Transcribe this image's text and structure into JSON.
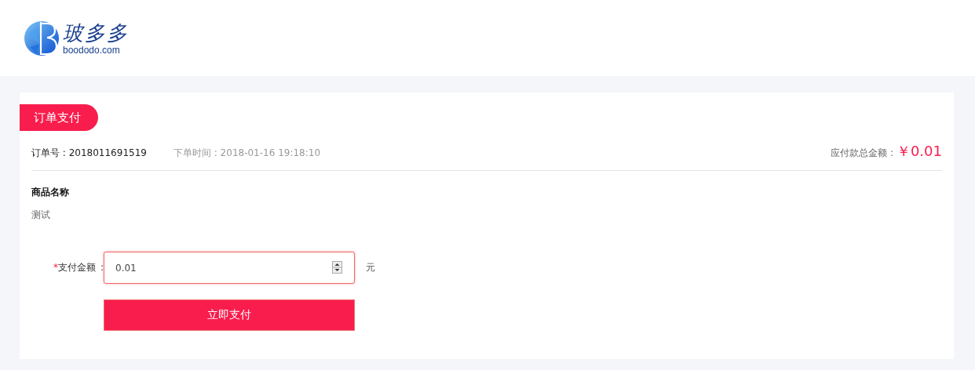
{
  "header": {
    "logo_text": "玻多多",
    "logo_domain": "boododo.com"
  },
  "panel": {
    "title": "订单支付",
    "order_number": "订单号 : 2018011691519",
    "order_time": "下单时间 : 2018-01-16 19:18:10",
    "total_label": "应付款总金额 :",
    "total_amount": "￥0.01",
    "product_heading": "商品名称",
    "product_name": "测试",
    "form": {
      "required_mark": "*",
      "label": "支付金额",
      "colon": ":",
      "value": "0.01",
      "unit": "元"
    },
    "submit": "立即支付"
  }
}
